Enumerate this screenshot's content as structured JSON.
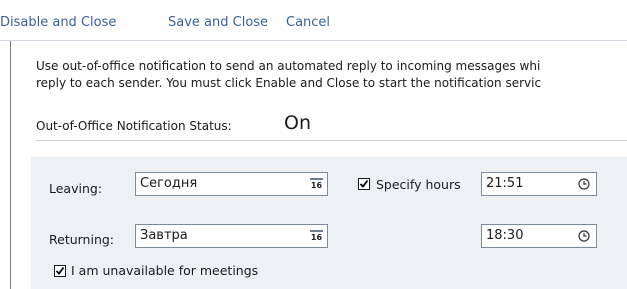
{
  "toolbar": {
    "disable_label": "Disable and Close",
    "save_label": "Save and Close",
    "cancel_label": "Cancel"
  },
  "description": {
    "line1": "Use out-of-office notification to send an automated reply to incoming messages whi",
    "line2": "reply to each sender. You must click Enable and Close to start the notification servic"
  },
  "status": {
    "label": "Out-of-Office Notification Status:",
    "value": "On"
  },
  "schedule": {
    "leaving_label": "Leaving:",
    "leaving_date": "Сегодня",
    "returning_label": "Returning:",
    "returning_date": "Завтра",
    "calendar_glyph": "16",
    "specify_hours_label": "Specify hours",
    "specify_hours_checked": true,
    "leaving_time": "21:51",
    "returning_time": "18:30",
    "unavailable_label": "I am unavailable for meetings",
    "unavailable_checked": true
  },
  "icons": [
    "calendar-icon",
    "clock-icon",
    "checkbox-checked-icon"
  ],
  "colors": {
    "link": "#3b5f9d",
    "panel_bg": "#eef1f4",
    "divider": "#c9d1db"
  }
}
